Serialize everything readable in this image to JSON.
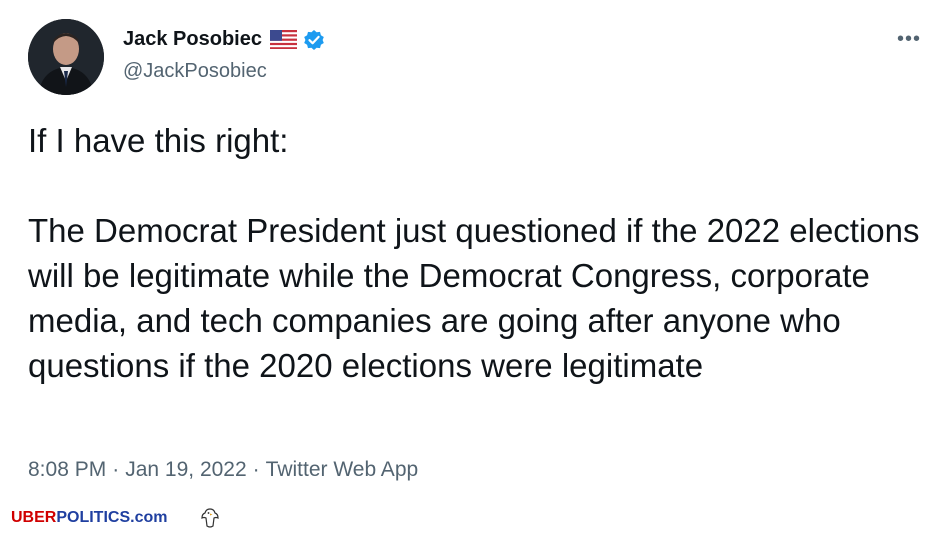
{
  "tweet": {
    "author": {
      "display_name": "Jack Posobiec",
      "handle": "@JackPosobiec",
      "flag_icon": "us-flag-icon",
      "verified_icon": "verified-badge-icon"
    },
    "more_label": "•••",
    "text": "If I have this right:\n\nThe Democrat President just questioned if the 2022 elections will be legitimate while the Democrat Congress, corporate media, and tech companies are going after anyone who questions if the 2020 elections were legitimate",
    "time": "8:08 PM",
    "separator": "·",
    "date": "Jan 19, 2022",
    "source": "Twitter Web App"
  },
  "watermark": {
    "part1": "UBER",
    "part2": "POLITICS.com"
  },
  "colors": {
    "text": "#0f1419",
    "secondary": "#536471",
    "verified": "#1d9bf0",
    "watermark_red": "#d00000",
    "watermark_blue": "#1f3fa0"
  }
}
